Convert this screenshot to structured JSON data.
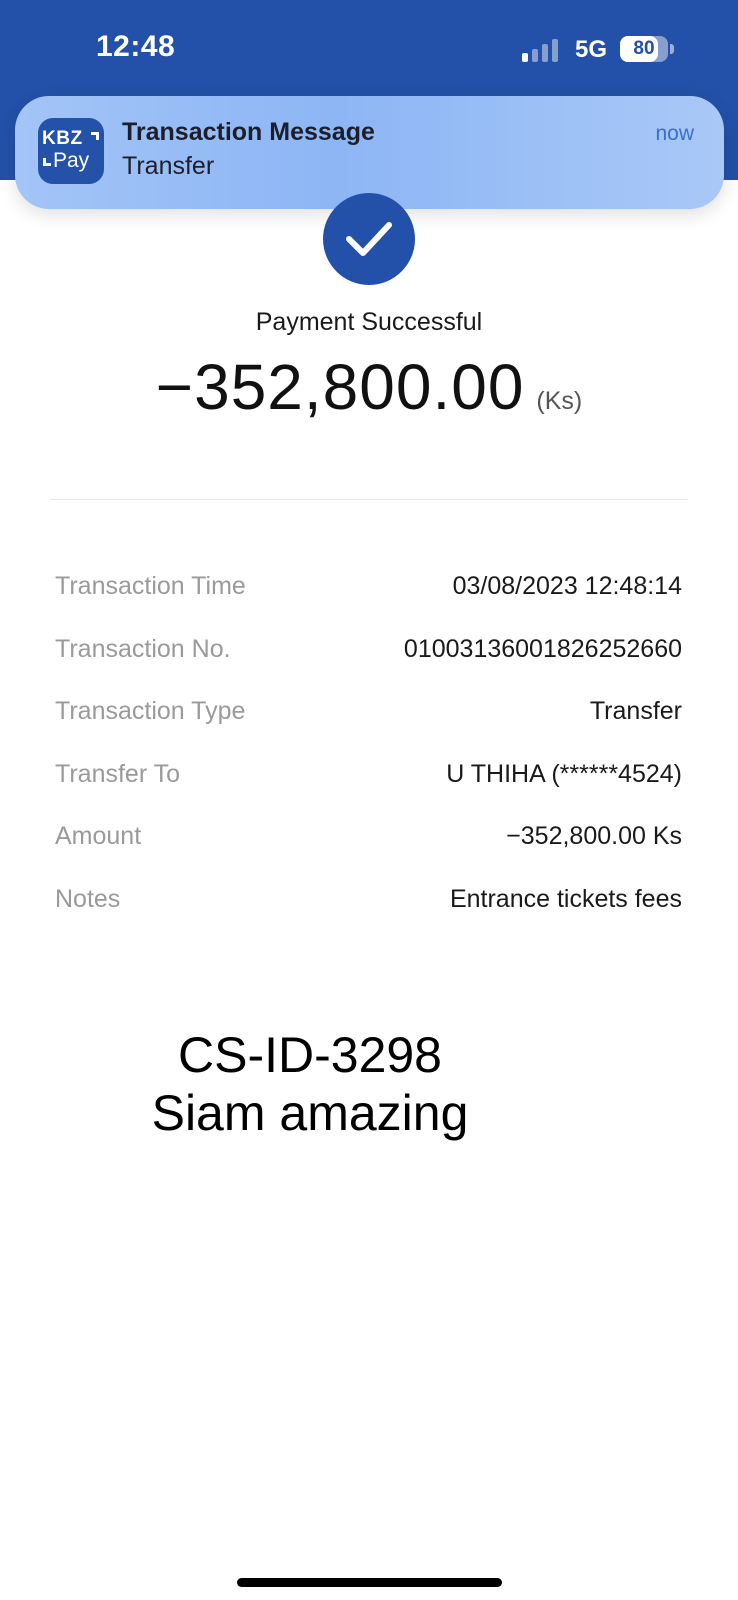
{
  "status_bar": {
    "time": "12:48",
    "network": "5G",
    "battery": "80",
    "battery_level": 0.8,
    "signal_bars_active": 1
  },
  "notification": {
    "app_icon": "kbzpay-app-icon",
    "app_icon_text_top": "KBZ",
    "app_icon_text_bottom": "Pay",
    "title": "Transaction Message",
    "body": "Transfer",
    "time": "now"
  },
  "receipt": {
    "status_icon": "checkmark-icon",
    "status_text": "Payment Successful",
    "amount": "−352,800.00",
    "currency": "(Ks)",
    "details": [
      {
        "label": "Transaction Time",
        "value": "03/08/2023 12:48:14"
      },
      {
        "label": "Transaction No.",
        "value": "01003136001826252660"
      },
      {
        "label": "Transaction Type",
        "value": "Transfer"
      },
      {
        "label": "Transfer To",
        "value": "U THIHA (******4524)"
      },
      {
        "label": "Amount",
        "value": "−352,800.00 Ks"
      },
      {
        "label": "Notes",
        "value": "Entrance tickets fees"
      }
    ]
  },
  "overlay": {
    "line1": "CS-ID-3298",
    "line2": "Siam amazing"
  },
  "colors": {
    "brand_blue": "#2350a8",
    "notification_bg": "#93b9f5",
    "label_gray": "#9a9a9a"
  }
}
